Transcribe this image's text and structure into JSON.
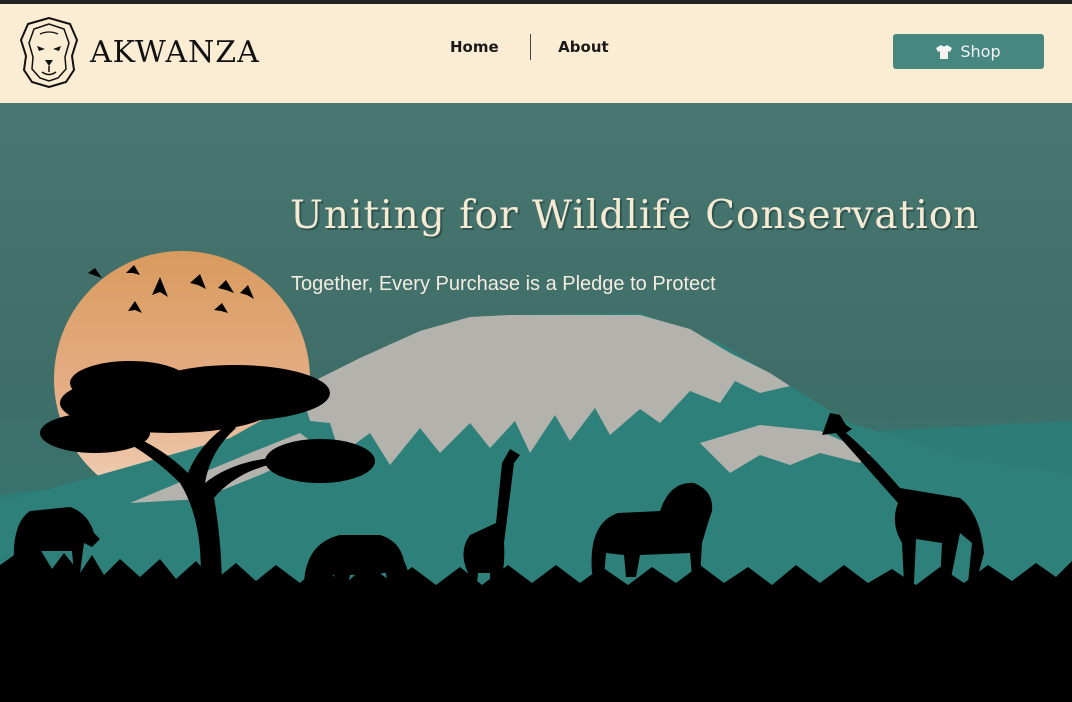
{
  "header": {
    "brand": "AKWANZA",
    "nav": [
      {
        "label": "Home"
      },
      {
        "label": "About"
      }
    ],
    "shop_label": "Shop"
  },
  "hero": {
    "title": "Uniting for Wildlife Conservation",
    "subtitle": "Together, Every Purchase is a Pledge to Protect"
  },
  "colors": {
    "header_bg": "#fbecd4",
    "accent": "#46887f",
    "sky": "#487670",
    "mountain": "#2f807a",
    "snow": "#b4b2ac",
    "sun": "#d99a60",
    "silhouette": "#000000"
  },
  "icons": {
    "logo": "lion-head-icon",
    "shop": "tshirt-icon"
  }
}
